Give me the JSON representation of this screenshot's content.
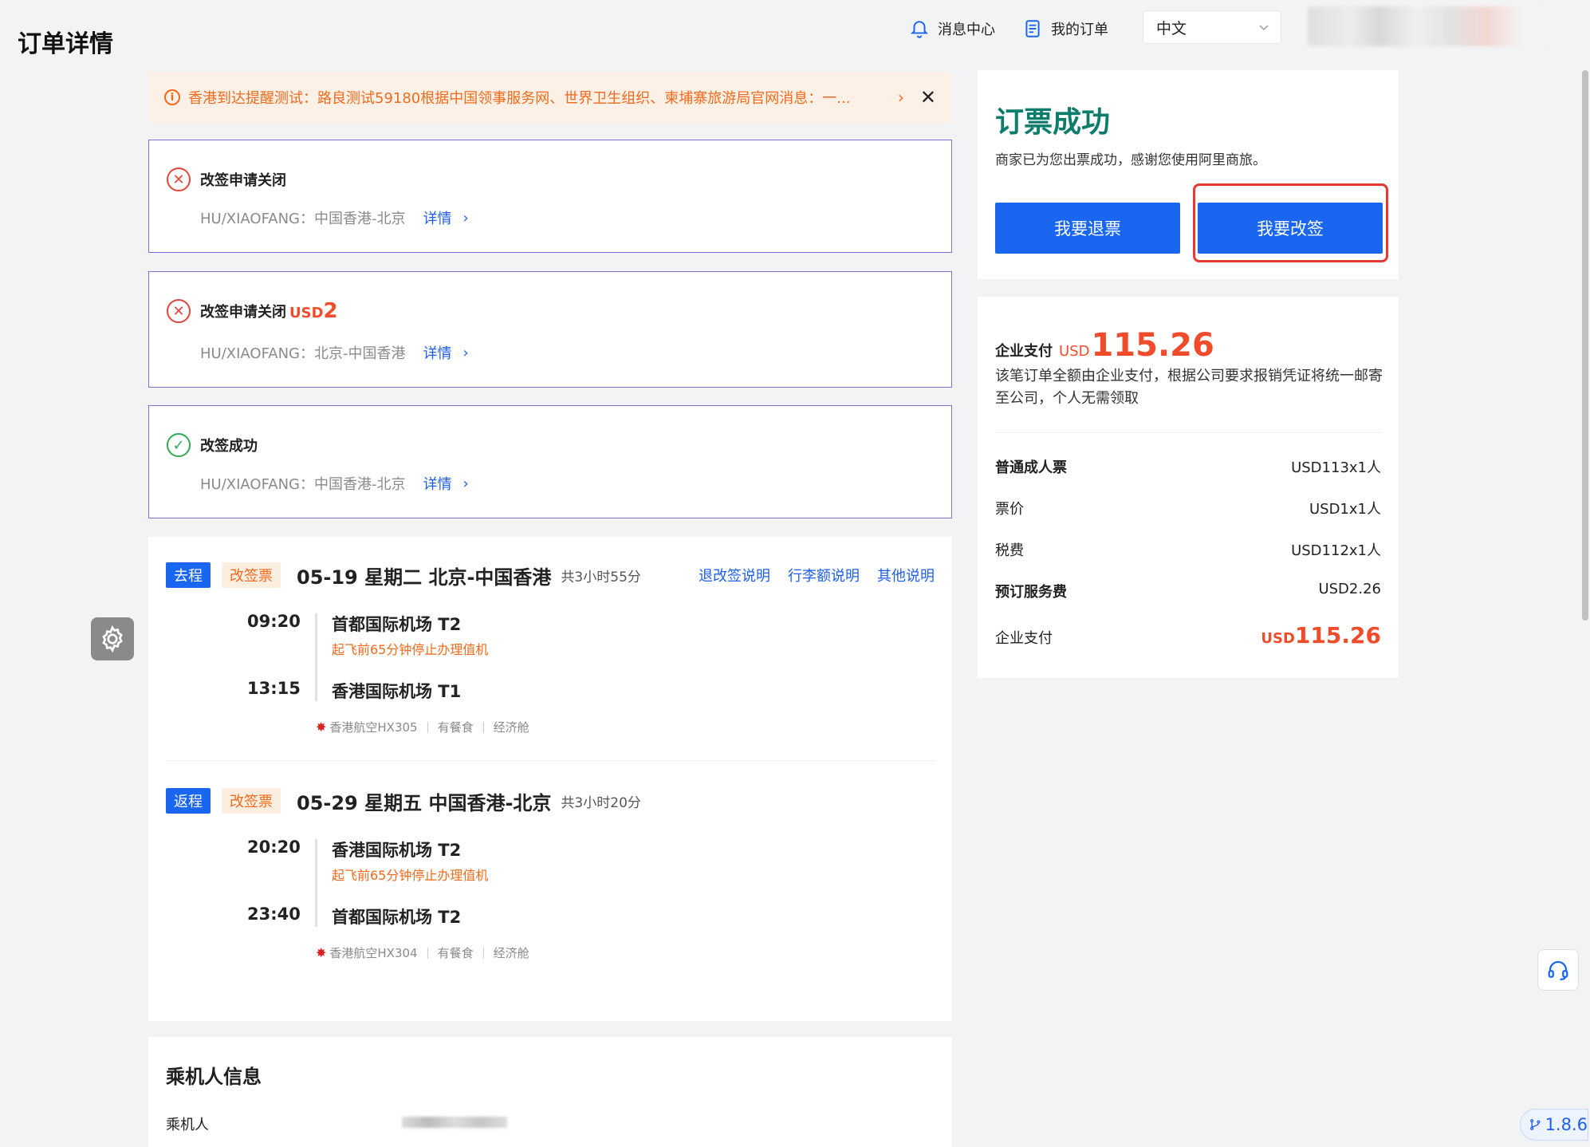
{
  "page": {
    "title": "订单详情"
  },
  "topnav": {
    "message_center": "消息中心",
    "my_orders": "我的订单",
    "language": "中文"
  },
  "notice": {
    "text": "香港到达提醒测试：路良测试59180根据中国领事服务网、世界卫生组织、柬埔寨旅游局官网消息：一..."
  },
  "change_requests": [
    {
      "status": "改签申请关闭",
      "amount_unit": "",
      "amount_value": "",
      "route": "HU/XIAOFANG：中国香港-北京",
      "detail": "详情",
      "state": "fail"
    },
    {
      "status": "改签申请关闭",
      "amount_unit": "USD",
      "amount_value": "2",
      "route": "HU/XIAOFANG：北京-中国香港",
      "detail": "详情",
      "state": "fail"
    },
    {
      "status": "改签成功",
      "amount_unit": "",
      "amount_value": "",
      "route": "HU/XIAOFANG：中国香港-北京",
      "detail": "详情",
      "state": "ok"
    }
  ],
  "segments": [
    {
      "direction": "去程",
      "ticket_type": "改签票",
      "title": "05-19 星期二 北京-中国香港",
      "duration": "共3小时55分",
      "links": [
        "退改签说明",
        "行李额说明",
        "其他说明"
      ],
      "dep_time": "09:20",
      "dep_airport": "首都国际机场 T2",
      "checkin_note": "起飞前65分钟停止办理值机",
      "arr_time": "13:15",
      "arr_airport": "香港国际机场 T1",
      "airline": "香港航空HX305",
      "meal": "有餐食",
      "cabin": "经济舱"
    },
    {
      "direction": "返程",
      "ticket_type": "改签票",
      "title": "05-29 星期五 中国香港-北京",
      "duration": "共3小时20分",
      "links": [],
      "dep_time": "20:20",
      "dep_airport": "香港国际机场 T2",
      "checkin_note": "起飞前65分钟停止办理值机",
      "arr_time": "23:40",
      "arr_airport": "首都国际机场 T2",
      "airline": "香港航空HX304",
      "meal": "有餐食",
      "cabin": "经济舱"
    }
  ],
  "passenger": {
    "section_title": "乘机人信息",
    "label": "乘机人"
  },
  "success": {
    "title": "订票成功",
    "subtitle": "商家已为您出票成功，感谢您使用阿里商旅。",
    "refund_button": "我要退票",
    "change_button": "我要改签"
  },
  "payment": {
    "label": "企业支付",
    "currency": "USD",
    "amount": "115.26",
    "note": "该笔订单全额由企业支付，根据公司要求报销凭证将统一邮寄至公司，个人无需领取",
    "rows": [
      {
        "key": "普通成人票",
        "value": "USD113x1人"
      },
      {
        "key": "票价",
        "value": "USD1x1人"
      },
      {
        "key": "税费",
        "value": "USD112x1人"
      },
      {
        "key": "预订服务费",
        "value": "USD2.26"
      }
    ],
    "total_label": "企业支付",
    "total_currency": "USD",
    "total_amount": "115.26"
  },
  "version": "1.8.6",
  "colors": {
    "primary": "#1a66f0",
    "accent_orange": "#f26a1b",
    "price_red": "#f04c2b",
    "success_green": "#0e7c6b",
    "card_border": "#7c6fd6"
  }
}
